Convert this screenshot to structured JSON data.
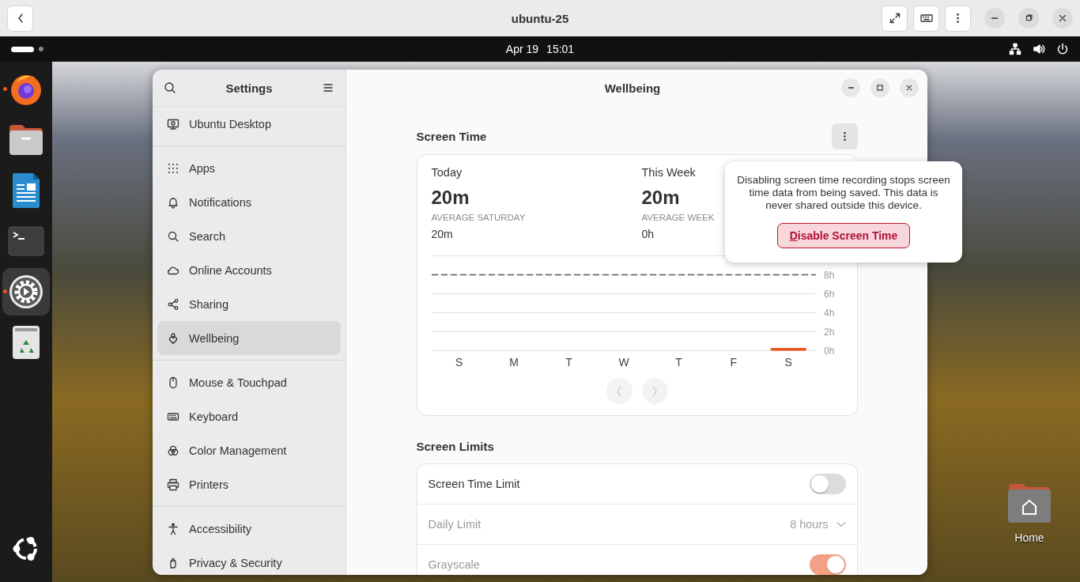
{
  "app_bar": {
    "title": "ubuntu-25"
  },
  "top_panel": {
    "date": "Apr 19",
    "time": "15:01"
  },
  "dock": [
    {
      "kind": "browser",
      "running": true,
      "selected": false
    },
    {
      "kind": "files",
      "running": false,
      "selected": false
    },
    {
      "kind": "writer",
      "running": false,
      "selected": false
    },
    {
      "kind": "terminal",
      "running": false,
      "selected": false
    },
    {
      "kind": "settings",
      "running": true,
      "selected": true
    },
    {
      "kind": "trash",
      "running": false,
      "selected": false
    },
    {
      "kind": "show-apps",
      "running": false,
      "selected": false
    }
  ],
  "desktop_icons": [
    {
      "label": "Home"
    }
  ],
  "settings": {
    "sidebar": {
      "title": "Settings",
      "groups": [
        {
          "items": [
            {
              "kind": "desktop",
              "label": "Ubuntu Desktop",
              "selected": false
            }
          ]
        },
        {
          "items": [
            {
              "kind": "apps",
              "label": "Apps",
              "selected": false
            },
            {
              "kind": "bell",
              "label": "Notifications",
              "selected": false
            },
            {
              "kind": "search",
              "label": "Search",
              "selected": false
            },
            {
              "kind": "cloud",
              "label": "Online Accounts",
              "selected": false
            },
            {
              "kind": "share",
              "label": "Sharing",
              "selected": false
            },
            {
              "kind": "wellbeing",
              "label": "Wellbeing",
              "selected": true
            }
          ]
        },
        {
          "items": [
            {
              "kind": "mouse",
              "label": "Mouse & Touchpad",
              "selected": false
            },
            {
              "kind": "keyboard",
              "label": "Keyboard",
              "selected": false
            },
            {
              "kind": "color",
              "label": "Color Management",
              "selected": false
            },
            {
              "kind": "printer",
              "label": "Printers",
              "selected": false
            }
          ]
        },
        {
          "items": [
            {
              "kind": "accessibility",
              "label": "Accessibility",
              "selected": false
            },
            {
              "kind": "privacy",
              "label": "Privacy & Security",
              "selected": false
            }
          ]
        }
      ]
    },
    "page": {
      "title": "Wellbeing",
      "screen_time": {
        "heading": "Screen Time",
        "stats": [
          {
            "label": "Today",
            "value": "20m",
            "sublabel": "AVERAGE SATURDAY",
            "subvalue": "20m"
          },
          {
            "label": "This Week",
            "value": "20m",
            "sublabel": "AVERAGE WEEK",
            "subvalue": "0h"
          }
        ],
        "chart_data": {
          "type": "bar",
          "categories": [
            "S",
            "M",
            "T",
            "W",
            "T",
            "F",
            "S"
          ],
          "values": [
            0,
            0,
            0,
            0,
            0,
            0,
            0.3
          ],
          "ylim": [
            0,
            10
          ],
          "grid": true,
          "yticks": [
            {
              "value": 0,
              "label": "0h"
            },
            {
              "value": 2,
              "label": "2h"
            },
            {
              "value": 4,
              "label": "4h"
            },
            {
              "value": 6,
              "label": "6h"
            },
            {
              "value": 8,
              "label": "8h"
            }
          ],
          "ref_lines": [
            {
              "axis": "y",
              "value": 8
            }
          ]
        },
        "nav": [
          {
            "kind": "previous",
            "disabled": true
          },
          {
            "kind": "next",
            "disabled": true
          }
        ],
        "popover": {
          "text": "Disabling screen time recording stops screen time data from being saved. This data is never shared outside this device.",
          "button": "Disable Screen Time"
        }
      },
      "screen_limits": {
        "heading": "Screen Limits",
        "rows": [
          {
            "kind": "switch",
            "label": "Screen Time Limit",
            "on": false,
            "disabled": false
          },
          {
            "kind": "dropdown",
            "label": "Daily Limit",
            "value": "8 hours",
            "disabled": true
          },
          {
            "kind": "switch",
            "label": "Grayscale",
            "on": true,
            "disabled": true
          }
        ]
      }
    }
  }
}
